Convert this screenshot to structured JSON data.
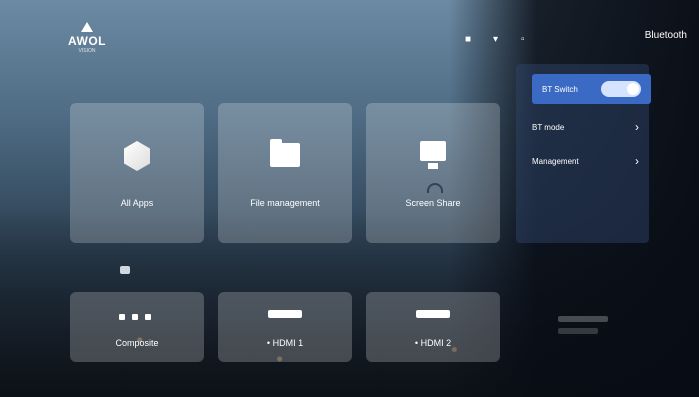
{
  "brand": {
    "name": "AWOL",
    "sub": "VISION"
  },
  "header": {
    "panel_title": "Bluetooth"
  },
  "apps": [
    {
      "label": "All Apps",
      "icon": "cube-icon"
    },
    {
      "label": "File management",
      "icon": "folder-icon"
    },
    {
      "label": "Screen Share",
      "icon": "screen-share-icon"
    }
  ],
  "inputs": [
    {
      "label": "Composite",
      "icon": "composite-icon"
    },
    {
      "label": "• HDMI 1",
      "icon": "hdmi-icon"
    },
    {
      "label": "• HDMI 2",
      "icon": "hdmi-icon"
    }
  ],
  "bluetooth_panel": {
    "items": [
      {
        "label": "BT Switch",
        "state": "on"
      },
      {
        "label": "BT mode"
      },
      {
        "label": "Management"
      }
    ],
    "accent": "#3b6ac4"
  }
}
